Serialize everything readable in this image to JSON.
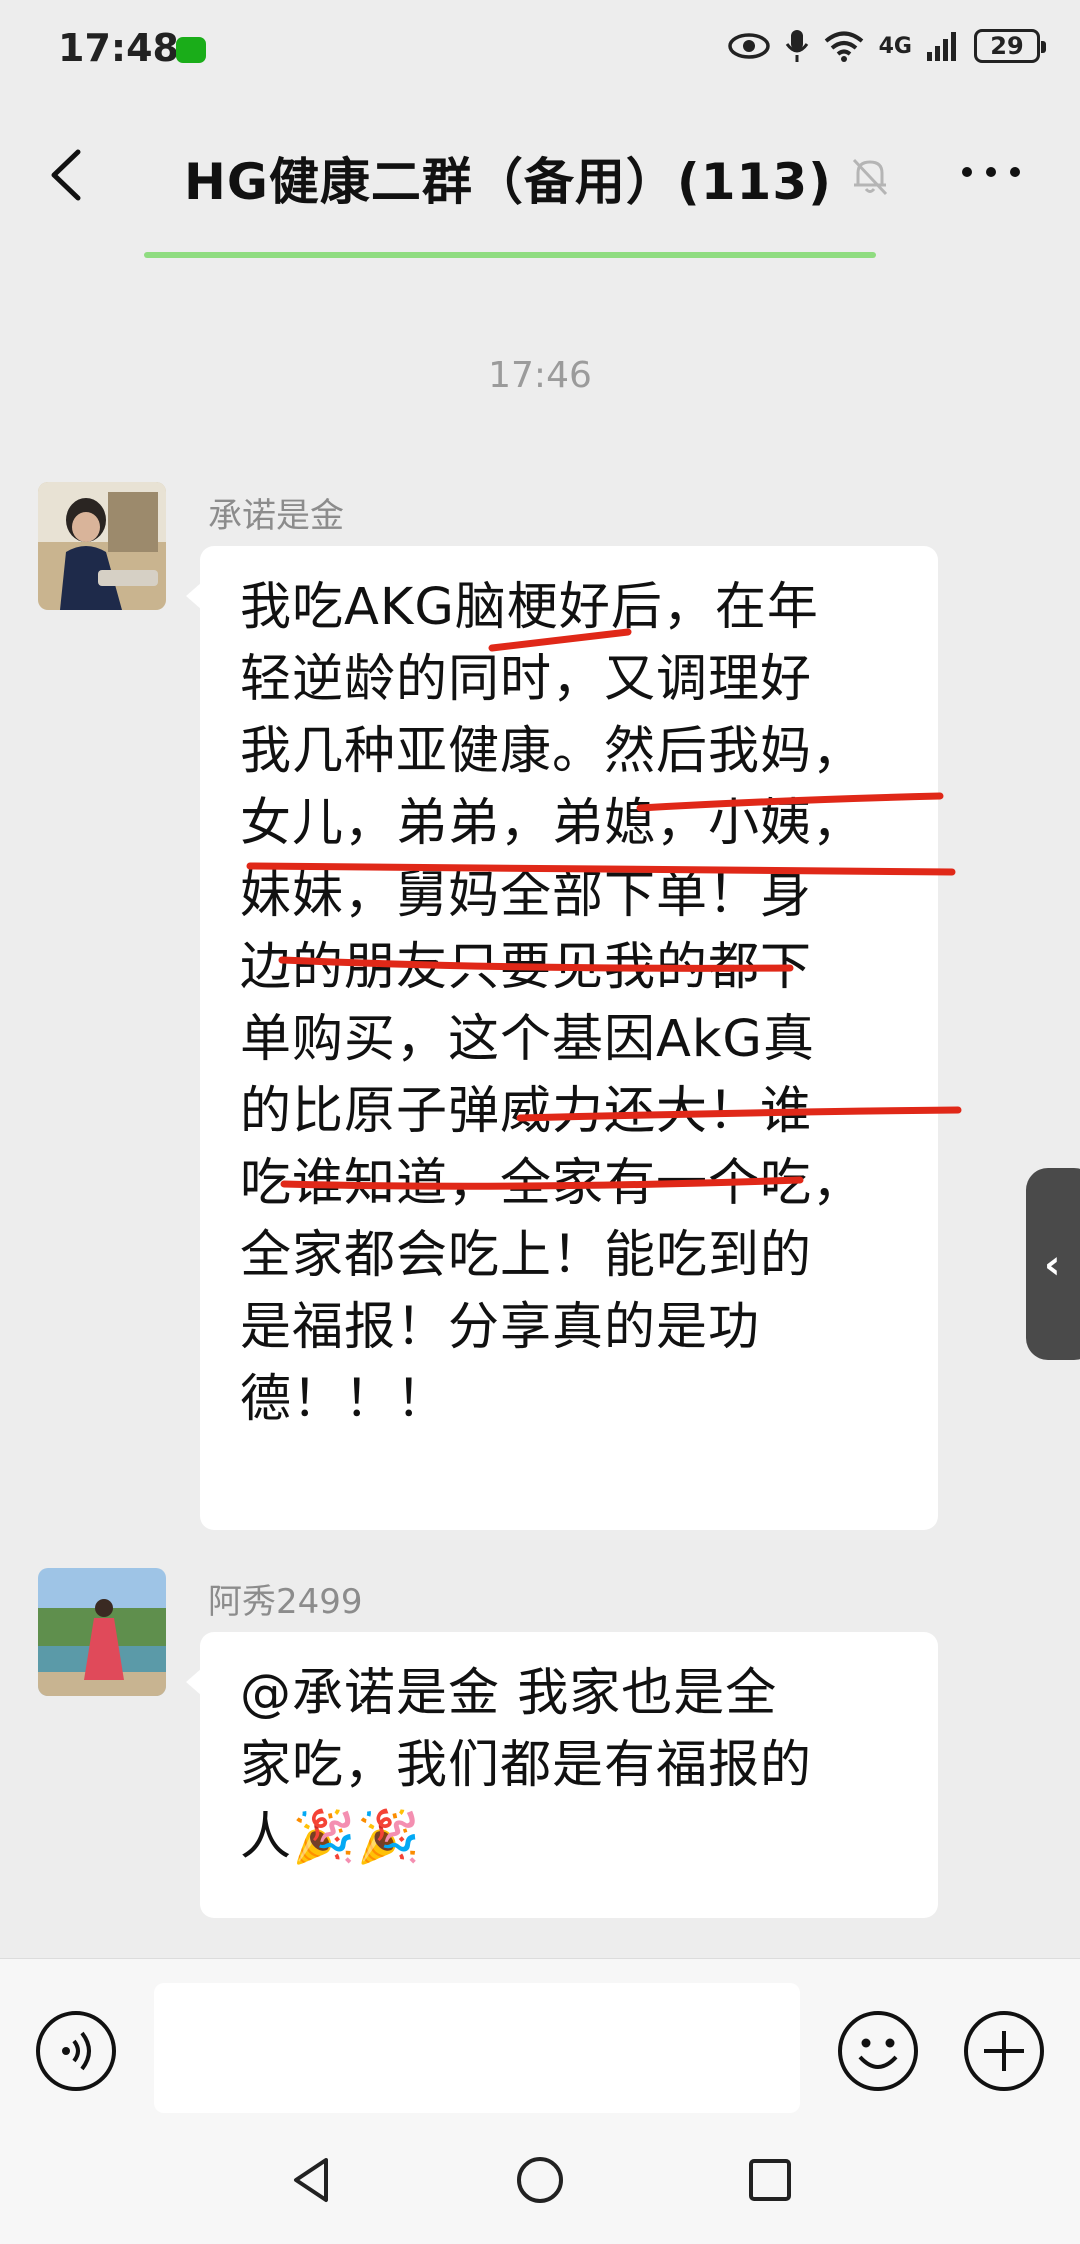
{
  "status_bar": {
    "time": "17:48",
    "network": "4G",
    "battery": "29"
  },
  "header": {
    "title": "HG健康二群（备用）(113)"
  },
  "chat": {
    "timestamp": "17:46",
    "messages": [
      {
        "sender": "承诺是金",
        "lines": [
          "我吃AKG脑梗好后，在年",
          "轻逆龄的同时，又调理好",
          "我几种亚健康。然后我妈，",
          "女儿，弟弟，弟媳，小姨，",
          "妹妹，舅妈全部下单！身",
          "边的朋友只要见我的都下",
          "单购买，这个基因AkG真",
          "的比原子弹威力还大！谁",
          "吃谁知道，全家有一个吃，",
          "全家都会吃上！能吃到的",
          "是福报！分享真的是功",
          "德！！！"
        ]
      },
      {
        "sender": "阿秀2499",
        "lines": [
          "@承诺是金  我家也是全",
          "家吃，我们都是有福报的",
          "人🎉🎉"
        ]
      }
    ]
  },
  "input": {
    "placeholder": ""
  },
  "colors": {
    "accent_green": "#8fdc80",
    "underline_red": "#e02818",
    "bubble": "#ffffff",
    "background": "#ededed"
  }
}
